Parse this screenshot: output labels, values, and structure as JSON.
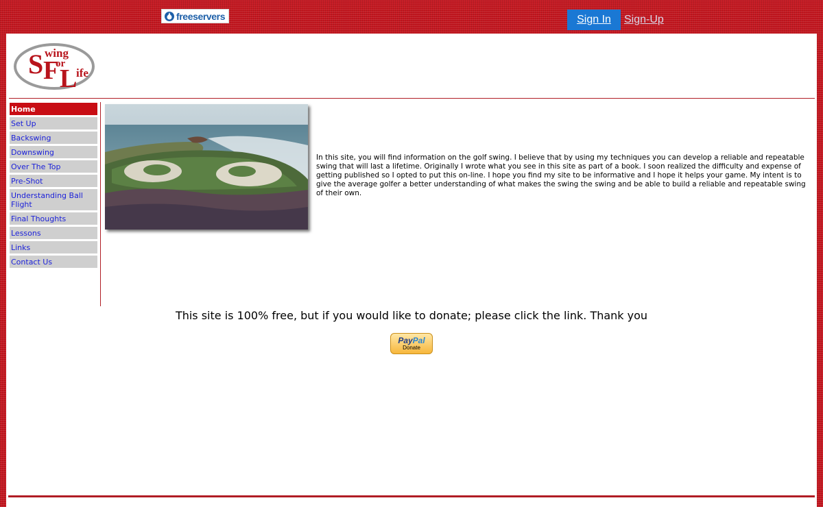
{
  "topbar": {
    "brand": "freeservers",
    "sign_in": "Sign In",
    "sign_up": "Sign-Up"
  },
  "logo": {
    "text": "Swing for Life"
  },
  "sidebar": {
    "items": [
      {
        "label": "Home",
        "active": true
      },
      {
        "label": "Set Up"
      },
      {
        "label": "Backswing"
      },
      {
        "label": "Downswing"
      },
      {
        "label": "Over The Top"
      },
      {
        "label": "Pre-Shot"
      },
      {
        "label": "Understanding Ball Flight"
      },
      {
        "label": "Final Thoughts"
      },
      {
        "label": "Lessons"
      },
      {
        "label": "Links"
      },
      {
        "label": "Contact Us"
      }
    ]
  },
  "main": {
    "intro": "In this site, you will find information on the golf swing. I believe that by using my techniques you can develop a reliable and repeatable swing that will last a lifetime. Originally I wrote what you see in this site as part of a book. I soon realized the difficulty and expense of getting published so I opted to put this on-line. I hope you find my site to be informative and I hope it helps your game. My intent is to give the average golfer a better understanding of what makes the swing the swing and be able to build a reliable and repeatable swing of their own.",
    "donate_text": "This site is 100% free, but if you would like to donate; please click the link. Thank you",
    "paypal_pay": "Pay",
    "paypal_pal": "Pal",
    "paypal_donate": "Donate"
  },
  "colors": {
    "brand_red": "#c4161f",
    "nav_link": "#1d22d9",
    "sign_in_bg": "#1a78d4"
  }
}
